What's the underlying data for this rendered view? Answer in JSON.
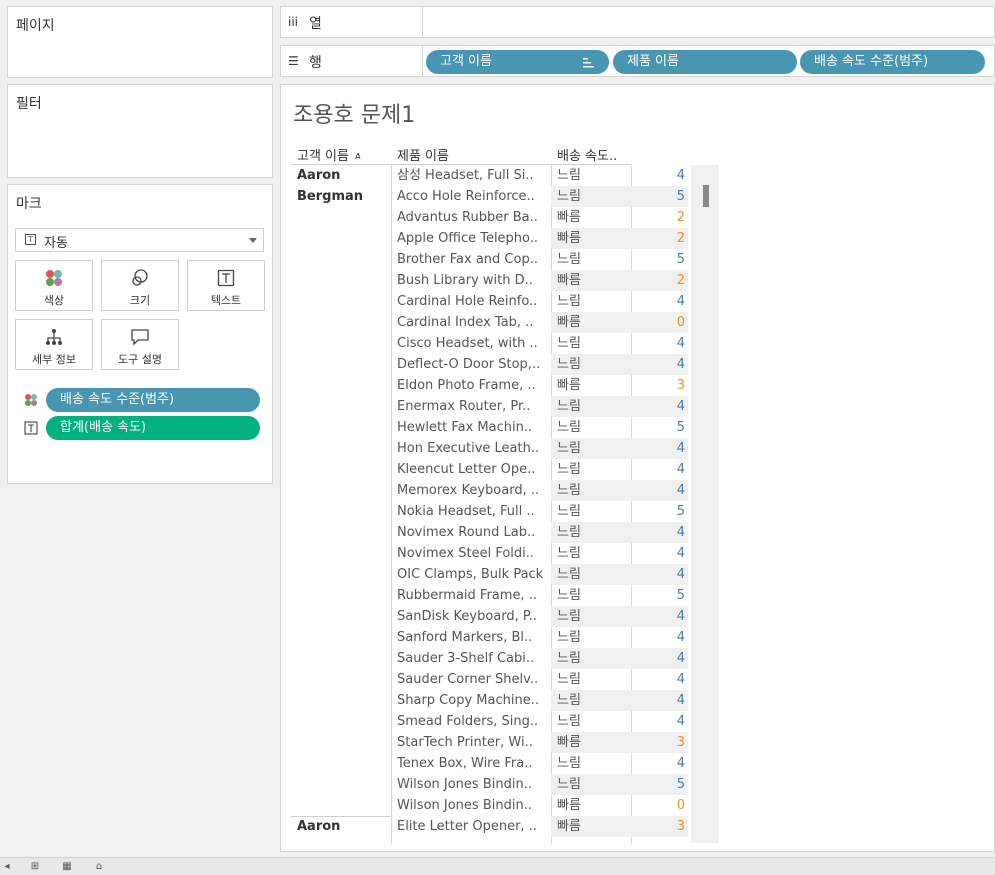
{
  "left": {
    "pages": {
      "title": "페이지"
    },
    "filters": {
      "title": "필터"
    },
    "marks": {
      "title": "마크",
      "type_value": "자동",
      "buttons": [
        {
          "label": "색상",
          "icon": "color-icon"
        },
        {
          "label": "크기",
          "icon": "size-icon"
        },
        {
          "label": "텍스트",
          "icon": "text-icon"
        },
        {
          "label": "세부 정보",
          "icon": "detail-icon"
        },
        {
          "label": "도구 설명",
          "icon": "tooltip-icon"
        }
      ],
      "pills": [
        {
          "label": "배송 속도 수준(범주)",
          "icon": "color-icon"
        },
        {
          "label": "합계(배송 속도)",
          "icon": "text-icon"
        }
      ]
    }
  },
  "shelves": {
    "columns": {
      "label": "열",
      "icon": "columns-icon"
    },
    "rows": {
      "label": "행",
      "icon": "rows-icon",
      "pills": [
        "고객 이름",
        "제품 이름",
        "배송 속도 수준(범주)"
      ]
    }
  },
  "view": {
    "title": "조용호 문제1",
    "headers": {
      "customer": "고객 이름",
      "product": "제품 이름",
      "speed": "배송 속도.."
    },
    "customers": [
      {
        "name_line1": "Aaron",
        "name_line2": "Bergman"
      },
      {
        "name_line1": "Aaron",
        "name_line2": ""
      }
    ],
    "rows": [
      {
        "product": "삼성 Headset, Full Si..",
        "speed": "느림",
        "value": "4"
      },
      {
        "product": "Acco Hole Reinforce..",
        "speed": "느림",
        "value": "5"
      },
      {
        "product": "Advantus Rubber Ba..",
        "speed": "빠름",
        "value": "2"
      },
      {
        "product": "Apple Office Telepho..",
        "speed": "빠름",
        "value": "2"
      },
      {
        "product": "Brother Fax and Cop..",
        "speed": "느림",
        "value": "5"
      },
      {
        "product": "Bush Library with D..",
        "speed": "빠름",
        "value": "2"
      },
      {
        "product": "Cardinal Hole Reinfo..",
        "speed": "느림",
        "value": "4"
      },
      {
        "product": "Cardinal Index Tab, ..",
        "speed": "빠름",
        "value": "0"
      },
      {
        "product": "Cisco Headset, with ..",
        "speed": "느림",
        "value": "4"
      },
      {
        "product": "Deflect-O Door Stop,..",
        "speed": "느림",
        "value": "4"
      },
      {
        "product": "Eldon Photo Frame, ..",
        "speed": "빠름",
        "value": "3"
      },
      {
        "product": "Enermax Router, Pr..",
        "speed": "느림",
        "value": "4"
      },
      {
        "product": "Hewlett Fax Machin..",
        "speed": "느림",
        "value": "5"
      },
      {
        "product": "Hon Executive Leath..",
        "speed": "느림",
        "value": "4"
      },
      {
        "product": "Kleencut Letter Ope..",
        "speed": "느림",
        "value": "4"
      },
      {
        "product": "Memorex Keyboard, ..",
        "speed": "느림",
        "value": "4"
      },
      {
        "product": "Nokia Headset, Full ..",
        "speed": "느림",
        "value": "5"
      },
      {
        "product": "Novimex Round Lab..",
        "speed": "느림",
        "value": "4"
      },
      {
        "product": "Novimex Steel Foldi..",
        "speed": "느림",
        "value": "4"
      },
      {
        "product": "OIC Clamps, Bulk Pack",
        "speed": "느림",
        "value": "4"
      },
      {
        "product": "Rubbermaid Frame, ..",
        "speed": "느림",
        "value": "5"
      },
      {
        "product": "SanDisk Keyboard, P..",
        "speed": "느림",
        "value": "4"
      },
      {
        "product": "Sanford Markers, Bl..",
        "speed": "느림",
        "value": "4"
      },
      {
        "product": "Sauder 3-Shelf Cabi..",
        "speed": "느림",
        "value": "4"
      },
      {
        "product": "Sauder Corner Shelv..",
        "speed": "느림",
        "value": "4"
      },
      {
        "product": "Sharp Copy Machine..",
        "speed": "느림",
        "value": "4"
      },
      {
        "product": "Smead Folders, Sing..",
        "speed": "느림",
        "value": "4"
      },
      {
        "product": "StarTech Printer, Wi..",
        "speed": "빠름",
        "value": "3"
      },
      {
        "product": "Tenex Box, Wire Fra..",
        "speed": "느림",
        "value": "4"
      },
      {
        "product": "Wilson Jones Bindin..",
        "speed": "느림",
        "value": "5"
      },
      {
        "product": "Wilson Jones Bindin..",
        "speed": "빠름",
        "value": "0"
      },
      {
        "product": "Elite Letter Opener, ..",
        "speed": "빠름",
        "value": "3"
      }
    ]
  },
  "colors": {
    "slow": "#4e79a7",
    "fast": "#f28e2b",
    "pill_blue": "#4996b2",
    "pill_green": "#00b180"
  }
}
